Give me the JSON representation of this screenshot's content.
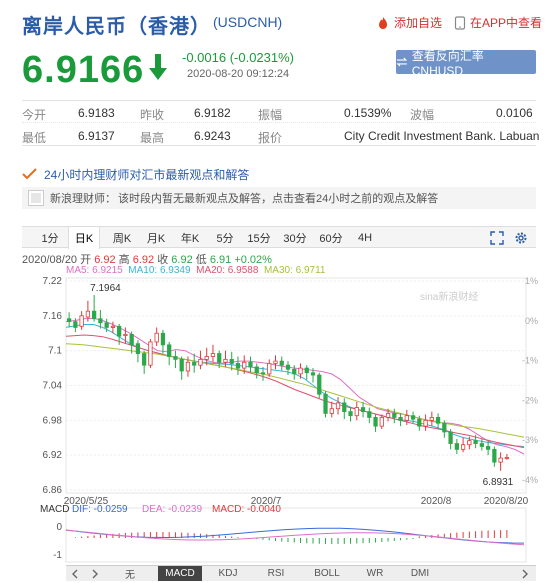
{
  "header": {
    "title": "离岸人民币（香港）",
    "code": "(USDCNH)",
    "add_watch": "添加自选",
    "app_view": "在APP中查看"
  },
  "quote": {
    "price": "6.9166",
    "change": "-0.0016 (-0.0231%)",
    "timestamp": "2020-08-20 09:12:24",
    "reverse_button": "查看反向汇率 CNHUSD"
  },
  "stats": [
    [
      {
        "label": "今开",
        "value": "6.9183"
      },
      {
        "label": "昨收",
        "value": "6.9182"
      },
      {
        "label": "振幅",
        "value": "0.1539%"
      },
      {
        "label": "波幅",
        "value": "0.0106"
      }
    ],
    [
      {
        "label": "最低",
        "value": "6.9137"
      },
      {
        "label": "最高",
        "value": "6.9243"
      },
      {
        "label": "报价",
        "value": "City Credit Investment Bank. Labuan"
      }
    ]
  ],
  "tip": {
    "headline": "24小时内理财师对汇市最新观点和解答",
    "author": "新浪理财师：",
    "message": "该时段内暂无最新观点及解答，点击查看24小时之前的观点及解答"
  },
  "tabs": [
    "1分",
    "日K",
    "周K",
    "月K",
    "年K",
    "5分",
    "15分",
    "30分",
    "60分",
    "4H"
  ],
  "active_tab": "日K",
  "info_line": {
    "date": "2020/08/20",
    "open_label": "开",
    "open": "6.92",
    "high_label": "高",
    "high": "6.92",
    "close_label": "收",
    "close": "6.92",
    "low_label": "低",
    "low": "6.91",
    "change": "+0.02%"
  },
  "ma": [
    {
      "label": "MA5: 6.9215",
      "color": "#e06ec8"
    },
    {
      "label": "MA10: 6.9349",
      "color": "#3ab4d8"
    },
    {
      "label": "MA20: 6.9588",
      "color": "#e0506e"
    },
    {
      "label": "MA30: 6.9711",
      "color": "#a6c23a"
    }
  ],
  "colors": {
    "up": "#e03a3a",
    "down": "#2aa84a"
  },
  "chart_data": {
    "type": "candlestick",
    "y_ticks": [
      "7.22",
      "7.16",
      "7.1",
      "7.04",
      "6.98",
      "6.92",
      "6.86"
    ],
    "y_range": [
      6.86,
      7.22
    ],
    "pct_ticks": [
      "1%",
      "0%",
      "-1%",
      "-2%",
      "-3%",
      "-4%"
    ],
    "x_ticks": [
      "2020/5/25",
      "2020/7",
      "2020/8",
      "2020/8/20"
    ],
    "annotations": {
      "max": "7.1964",
      "min": "6.8931"
    },
    "watermark": "sina新浪财经",
    "candles": [
      [
        7.155,
        7.15,
        7.166,
        7.14
      ],
      [
        7.15,
        7.14,
        7.156,
        7.132
      ],
      [
        7.142,
        7.16,
        7.168,
        7.136
      ],
      [
        7.158,
        7.168,
        7.186,
        7.15
      ],
      [
        7.168,
        7.155,
        7.196,
        7.15
      ],
      [
        7.155,
        7.148,
        7.17,
        7.138
      ],
      [
        7.148,
        7.14,
        7.155,
        7.132
      ],
      [
        7.14,
        7.142,
        7.15,
        7.13
      ],
      [
        7.142,
        7.125,
        7.146,
        7.11
      ],
      [
        7.126,
        7.128,
        7.14,
        7.112
      ],
      [
        7.128,
        7.11,
        7.133,
        7.095
      ],
      [
        7.112,
        7.095,
        7.118,
        7.08
      ],
      [
        7.095,
        7.075,
        7.1,
        7.06
      ],
      [
        7.075,
        7.115,
        7.12,
        7.07
      ],
      [
        7.115,
        7.13,
        7.14,
        7.108
      ],
      [
        7.13,
        7.11,
        7.136,
        7.095
      ],
      [
        7.11,
        7.09,
        7.115,
        7.075
      ],
      [
        7.09,
        7.085,
        7.1,
        7.07
      ],
      [
        7.085,
        7.065,
        7.09,
        7.05
      ],
      [
        7.065,
        7.08,
        7.09,
        7.055
      ],
      [
        7.08,
        7.075,
        7.095,
        7.062
      ],
      [
        7.075,
        7.085,
        7.1,
        7.068
      ],
      [
        7.085,
        7.09,
        7.105,
        7.075
      ],
      [
        7.09,
        7.095,
        7.11,
        7.08
      ],
      [
        7.095,
        7.08,
        7.1,
        7.07
      ],
      [
        7.08,
        7.085,
        7.1,
        7.072
      ],
      [
        7.085,
        7.078,
        7.098,
        7.066
      ],
      [
        7.078,
        7.07,
        7.09,
        7.058
      ],
      [
        7.07,
        7.08,
        7.092,
        7.06
      ],
      [
        7.08,
        7.072,
        7.09,
        7.062
      ],
      [
        7.072,
        7.062,
        7.078,
        7.052
      ],
      [
        7.062,
        7.06,
        7.072,
        7.048
      ],
      [
        7.06,
        7.078,
        7.085,
        7.055
      ],
      [
        7.078,
        7.082,
        7.092,
        7.068
      ],
      [
        7.082,
        7.075,
        7.09,
        7.066
      ],
      [
        7.075,
        7.068,
        7.082,
        7.058
      ],
      [
        7.068,
        7.06,
        7.075,
        7.05
      ],
      [
        7.06,
        7.07,
        7.078,
        7.052
      ],
      [
        7.07,
        7.062,
        7.075,
        7.05
      ],
      [
        7.062,
        7.058,
        7.07,
        7.045
      ],
      [
        7.058,
        7.025,
        7.062,
        7.018
      ],
      [
        7.025,
        6.992,
        7.03,
        6.985
      ],
      [
        6.992,
        7.0,
        7.012,
        6.985
      ],
      [
        7.0,
        7.01,
        7.02,
        6.99
      ],
      [
        7.01,
        6.995,
        7.018,
        6.982
      ],
      [
        6.995,
        6.988,
        7.002,
        6.978
      ],
      [
        6.988,
        7.002,
        7.012,
        6.98
      ],
      [
        7.002,
        6.995,
        7.012,
        6.985
      ],
      [
        6.995,
        6.985,
        7.002,
        6.975
      ],
      [
        6.985,
        6.97,
        6.99,
        6.96
      ],
      [
        6.97,
        6.985,
        6.99,
        6.965
      ],
      [
        6.985,
        6.992,
        7.0,
        6.978
      ],
      [
        6.992,
        6.985,
        7.0,
        6.975
      ],
      [
        6.985,
        6.98,
        6.992,
        6.97
      ],
      [
        6.98,
        6.988,
        6.998,
        6.972
      ],
      [
        6.988,
        6.982,
        6.995,
        6.975
      ],
      [
        6.982,
        6.97,
        6.988,
        6.962
      ],
      [
        6.97,
        6.98,
        6.99,
        6.962
      ],
      [
        6.98,
        6.985,
        6.995,
        6.97
      ],
      [
        6.985,
        6.975,
        6.992,
        6.965
      ],
      [
        6.975,
        6.96,
        6.98,
        6.95
      ],
      [
        6.96,
        6.94,
        6.965,
        6.93
      ],
      [
        6.94,
        6.93,
        6.948,
        6.922
      ],
      [
        6.93,
        6.938,
        6.95,
        6.925
      ],
      [
        6.938,
        6.945,
        6.952,
        6.93
      ],
      [
        6.945,
        6.94,
        6.955,
        6.932
      ],
      [
        6.94,
        6.935,
        6.948,
        6.928
      ],
      [
        6.935,
        6.93,
        6.945,
        6.92
      ],
      [
        6.93,
        6.908,
        6.935,
        6.9
      ],
      [
        6.908,
        6.915,
        6.925,
        6.893
      ],
      [
        6.915,
        6.916,
        6.922,
        6.912
      ]
    ],
    "ma_lines": {
      "ma5": [
        7.15,
        7.152,
        7.155,
        7.156,
        7.152,
        7.146,
        7.138,
        7.13,
        7.12,
        7.11,
        7.1,
        7.098,
        7.102,
        7.1,
        7.092,
        7.085,
        7.08,
        7.078,
        7.08,
        7.082,
        7.082,
        7.08,
        7.078,
        7.075,
        7.072,
        7.07,
        7.068,
        7.066,
        7.064,
        7.06,
        7.05,
        7.035,
        7.02,
        7.01,
        7.0,
        6.996,
        6.992,
        6.99,
        6.986,
        6.982,
        6.978,
        6.976,
        6.975,
        6.972,
        6.965,
        6.955,
        6.945,
        6.938,
        6.935,
        6.93,
        6.922
      ],
      "ma10": [
        7.14,
        7.143,
        7.145,
        7.145,
        7.14,
        7.132,
        7.122,
        7.112,
        7.105,
        7.1,
        7.096,
        7.092,
        7.088,
        7.085,
        7.082,
        7.08,
        7.078,
        7.077,
        7.076,
        7.074,
        7.072,
        7.07,
        7.068,
        7.066,
        7.064,
        7.06,
        7.052,
        7.04,
        7.028,
        7.018,
        7.01,
        7.003,
        6.998,
        6.994,
        6.99,
        6.986,
        6.982,
        6.98,
        6.978,
        6.974,
        6.97,
        6.965,
        6.958,
        6.952,
        6.948,
        6.945,
        6.942,
        6.94,
        6.938,
        6.936,
        6.935
      ],
      "ma20": [
        7.125,
        7.126,
        7.127,
        7.126,
        7.124,
        7.12,
        7.115,
        7.11,
        7.105,
        7.1,
        7.096,
        7.092,
        7.088,
        7.085,
        7.082,
        7.079,
        7.076,
        7.073,
        7.07,
        7.066,
        7.062,
        7.058,
        7.053,
        7.047,
        7.04,
        7.033,
        7.027,
        7.021,
        7.015,
        7.01,
        7.006,
        7.002,
        6.998,
        6.994,
        6.99,
        6.986,
        6.982,
        6.978,
        6.974,
        6.97,
        6.967,
        6.964,
        6.96,
        6.957,
        6.954,
        6.95,
        6.946,
        6.942,
        6.939,
        6.936,
        6.933
      ],
      "ma30": [
        7.112,
        7.111,
        7.11,
        7.108,
        7.106,
        7.104,
        7.102,
        7.1,
        7.098,
        7.096,
        7.094,
        7.091,
        7.088,
        7.085,
        7.082,
        7.079,
        7.076,
        7.073,
        7.07,
        7.067,
        7.064,
        7.061,
        7.058,
        7.054,
        7.05,
        7.046,
        7.042,
        7.037,
        7.032,
        7.027,
        7.022,
        7.017,
        7.012,
        7.007,
        7.002,
        6.998,
        6.994,
        6.99,
        6.986,
        6.982,
        6.979,
        6.976,
        6.973,
        6.97,
        6.968,
        6.966,
        6.963,
        6.96,
        6.957,
        6.954,
        6.951
      ]
    }
  },
  "macd": {
    "label": "MACD",
    "dif": "DIF: -0.0259",
    "dea": "DEA: -0.0239",
    "macd": "MACD: -0.0040",
    "y_ticks": [
      "0",
      "-1"
    ]
  },
  "bottom_tabs": [
    "无",
    "MACD",
    "KDJ",
    "RSI",
    "BOLL",
    "WR",
    "DMI"
  ],
  "active_bottom": "MACD"
}
